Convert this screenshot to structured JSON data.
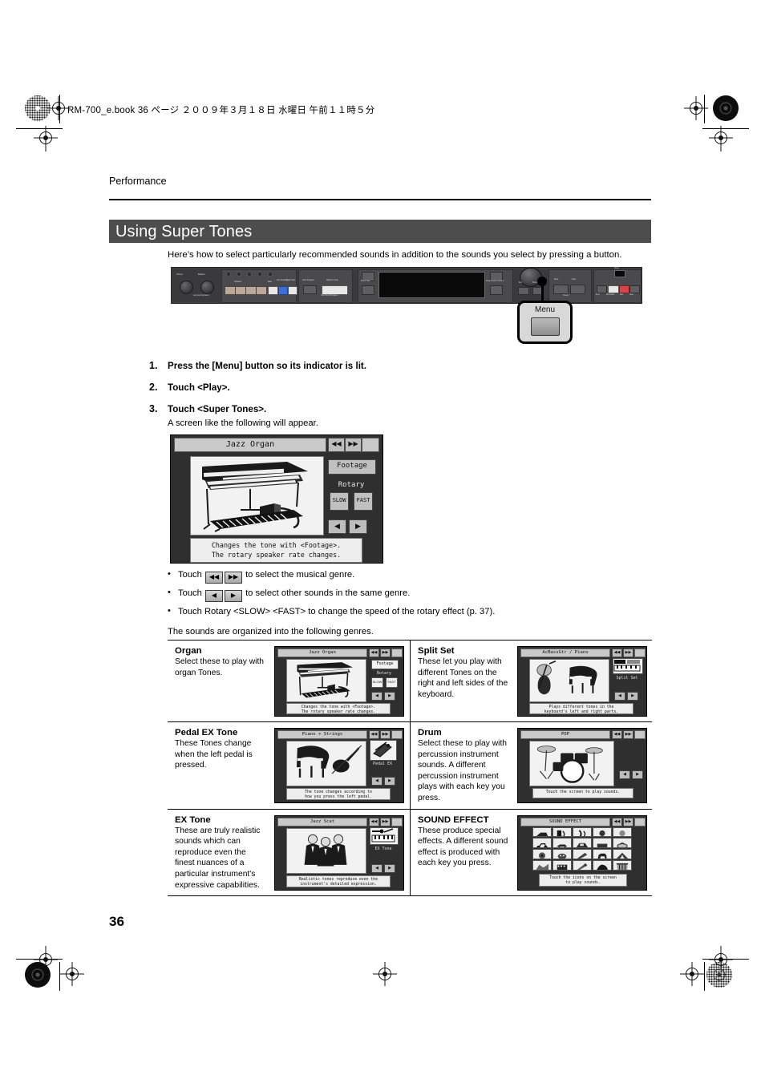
{
  "header": {
    "book_line": "RM-700_e.book  36 ページ  ２００９年３月１８日  水曜日  午前１１時５分"
  },
  "running_head": "Performance",
  "chapter_title": "Using Super Tones",
  "intro": "Here’s how to select particularly recommended sounds in addition to the sounds you select by pressing a button.",
  "panel": {
    "callout_label": "Menu",
    "labels": {
      "volume": "Volume",
      "balance": "Balance",
      "variation": "Variation",
      "beat": "Beat",
      "intro_ending": "Intro/ Ending",
      "start_stop": "Start/ Stop",
      "sync": "Sync",
      "user_program": "User Program",
      "rhythm_tone": "Rhythm/ Tone",
      "one_touch": "One Touch Program",
      "piano_solo": "Piano Solo",
      "performance_lesson": "Performance Lesson",
      "exit": "Exit",
      "menu": "Menu",
      "slow": "Slow",
      "fast": "Fast",
      "tempo": "Tempo",
      "prev": "Prev",
      "playstop": "Play/Stop",
      "rec": "Rec",
      "next": "Next",
      "song": "Song"
    }
  },
  "steps": [
    {
      "num": "1.",
      "text": "Press the [Menu] button so its indicator is lit."
    },
    {
      "num": "2.",
      "text": "Touch <Play>."
    },
    {
      "num": "3.",
      "text": "Touch <Super Tones>.",
      "sub": "A screen like the following will appear."
    }
  ],
  "main_screen": {
    "title": "Jazz Organ",
    "nav_prev": "◀◀",
    "nav_next": "▶▶",
    "footage_label": "Footage",
    "rotary_label": "Rotary",
    "slow_label": "SLOW",
    "fast_label": "FAST",
    "arrow_left": "◀",
    "arrow_right": "▶",
    "caption_line1": "Changes the tone with <Footage>.",
    "caption_line2": "The rotary speaker rate changes."
  },
  "bullets": [
    {
      "lead": "Touch",
      "key1": "◀◀",
      "key2": "▶▶",
      "tail": "to select the musical genre."
    },
    {
      "lead": "Touch",
      "key1": "◀",
      "key2": "▶",
      "tail": "to select other sounds in the same genre."
    },
    {
      "plain": "Touch Rotary <SLOW> <FAST> to change the speed of the rotary effect (p. 37)."
    }
  ],
  "summary_line": "The sounds are organized into the following genres.",
  "genres": [
    {
      "name": "Organ",
      "desc": "Select these to play with organ Tones.",
      "screen": {
        "title": "Jazz Organ",
        "side_button": "Footage",
        "side_label": "Rotary",
        "sub_buttons": [
          "SLOW",
          "FAST"
        ],
        "caption_line1": "Changes the tone with <Footage>.",
        "caption_line2": "The rotary speaker rate changes.",
        "art": "organ"
      }
    },
    {
      "name": "Split Set",
      "desc": "These let you play with different Tones on the right and left sides of the keyboard.",
      "screen": {
        "title": "AcBassGtr / Piano",
        "side_label": "Split Set",
        "caption_line1": "Plays different tones in the",
        "caption_line2": "keyboard's left and right parts.",
        "art": "bass-piano"
      }
    },
    {
      "name": "Pedal EX Tone",
      "desc": "These Tones change when the left pedal is pressed.",
      "screen": {
        "title": "Piano + Strings",
        "side_label": "Pedal EX",
        "caption_line1": "The tone changes according to",
        "caption_line2": "how you press the left pedal.",
        "art": "piano-strings"
      }
    },
    {
      "name": "Drum",
      "desc": "Select these to play with percussion instrument sounds. A different percussion instrument plays with each key you press.",
      "screen": {
        "title": "POP",
        "caption_line1": "Touch the screen to play sounds.",
        "caption_line2": "",
        "art": "drumkit"
      }
    },
    {
      "name": "EX Tone",
      "desc": "These are truly realistic sounds which can reproduce even the finest nuances of a particular instrument's expressive capabilities.",
      "screen": {
        "title": "Jazz Scat",
        "side_label": "EX Tone",
        "caption_line1": "Realistic tones reproduce even the",
        "caption_line2": "instrument's detailed expression.",
        "art": "singers"
      }
    },
    {
      "name": "SOUND EFFECT",
      "desc": "These produce special effects. A different sound effect is produced with each key you press.",
      "screen": {
        "title": "SOUND EFFECT",
        "caption_line1": "Touch the icons on the screen",
        "caption_line2": "to play sounds.",
        "art": "sfx-grid"
      }
    }
  ],
  "page_number": "36",
  "colors": {
    "title_bar": "#4d4d4d",
    "panel": "#3a3a3c",
    "lcd_body": "#2f2f2f",
    "accent_red": "#d8434a",
    "accent_blue": "#3a6fd8"
  }
}
